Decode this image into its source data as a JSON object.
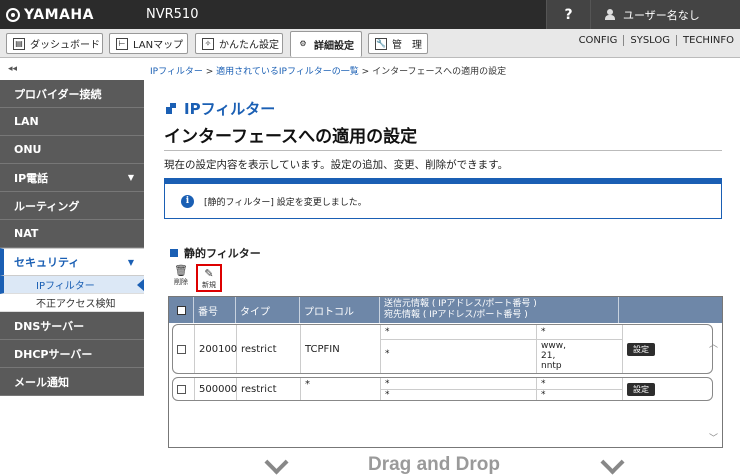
{
  "header": {
    "brand": "YAMAHA",
    "model": "NVR510",
    "help": "?",
    "user": "ユーザー名なし"
  },
  "tabs": [
    {
      "label": "ダッシュボード",
      "icon": "dashboard-icon"
    },
    {
      "label": "LANマップ",
      "icon": "lan-map-icon"
    },
    {
      "label": "かんたん設定",
      "icon": "wand-icon"
    },
    {
      "label": "詳細設定",
      "icon": "gear-icon",
      "active": true
    },
    {
      "label": "管　理",
      "icon": "wrench-icon"
    }
  ],
  "sys_links": [
    "CONFIG",
    "SYSLOG",
    "TECHINFO"
  ],
  "collapse": "◂◂",
  "breadcrumb": {
    "link1": "IPフィルター",
    "sep": " > ",
    "link2": "適用されているIPフィルターの一覧",
    "current": "インターフェースへの適用の設定"
  },
  "sidebar": {
    "items": [
      "プロバイダー接続",
      "LAN",
      "ONU",
      "IP電話",
      "ルーティング",
      "NAT",
      "セキュリティ"
    ],
    "sub": [
      "IPフィルター",
      "不正アクセス検知"
    ],
    "items_after": [
      "DNSサーバー",
      "DHCPサーバー",
      "メール通知"
    ]
  },
  "page": {
    "subtitle": "IPフィルター",
    "title": "インターフェースへの適用の設定",
    "desc": "現在の設定内容を表示しています。設定の追加、変更、削除ができます。",
    "notice": "[静的フィルター] 設定を変更しました。",
    "section": "静的フィルター",
    "tool_delete": "削除",
    "tool_new": "新規"
  },
  "table": {
    "headers": {
      "no": "番号",
      "type": "タイプ",
      "proto": "プロトコル",
      "src": "送信元情報 ( IPアドレス/ポート番号 )",
      "dst": "宛先情報 ( IPアドレス/ポート番号 )"
    },
    "rows": [
      {
        "no": "200100",
        "type": "restrict",
        "proto": "TCPFIN",
        "src_ip": "*",
        "src_port": "*",
        "dst_ip": "*",
        "dst_port1": "www,",
        "dst_port2": "21,",
        "dst_port3": "nntp",
        "btn": "設定"
      },
      {
        "no": "500000",
        "type": "restrict",
        "proto": "*",
        "src_ip": "*",
        "src_port": "*",
        "dst_ip": "*",
        "dst_port1": "*",
        "btn": "設定"
      }
    ]
  },
  "dnd": "Drag and Drop"
}
